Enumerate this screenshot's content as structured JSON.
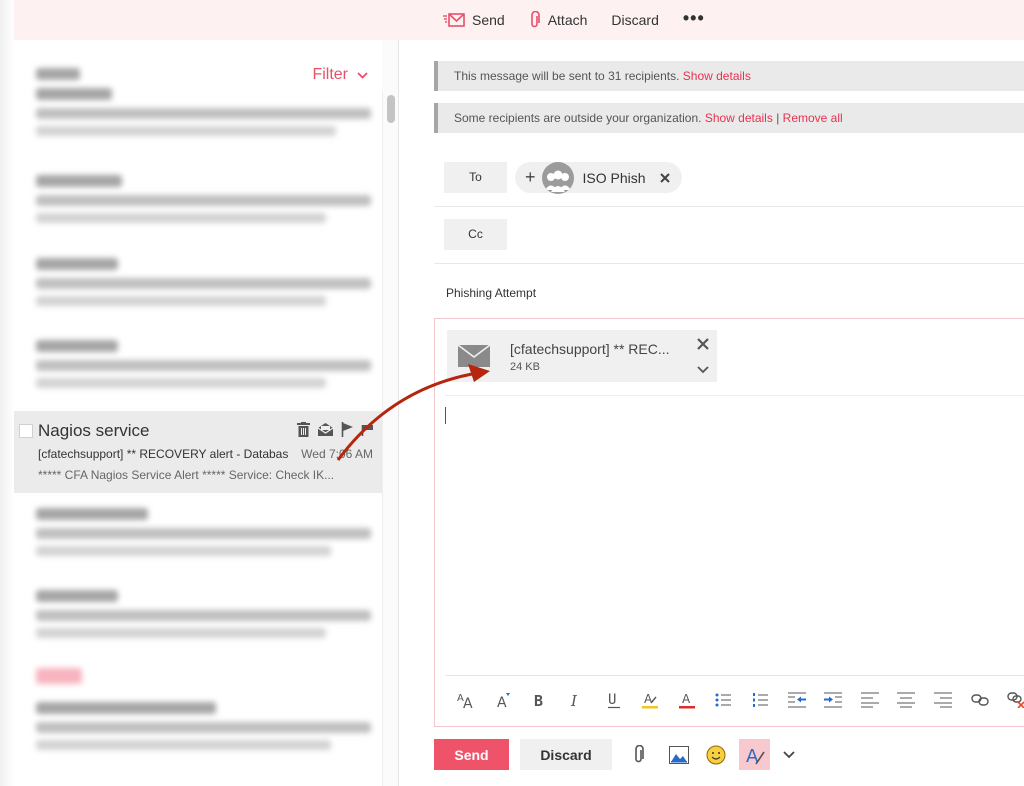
{
  "toolbar": {
    "send_label": "Send",
    "attach_label": "Attach",
    "discard_label": "Discard",
    "more_label": "•••"
  },
  "list": {
    "filter_label": "Filter",
    "selected_message": {
      "sender": "Nagios service",
      "subject": "[cfatechsupport] ** RECOVERY alert - Databas",
      "date": "Wed 7:06 AM",
      "preview": "***** CFA Nagios Service Alert ***** Service: Check IK..."
    }
  },
  "compose": {
    "info_recipients": {
      "text": "This message will be sent to 31 recipients. ",
      "link": "Show details"
    },
    "info_external": {
      "text": "Some recipients are outside your organization. ",
      "link1": "Show details",
      "separator": " | ",
      "link2": "Remove all"
    },
    "to_label": "To",
    "cc_label": "Cc",
    "recipient": {
      "plus": "+",
      "name": "ISO Phish"
    },
    "subject": "Phishing Attempt",
    "attachment": {
      "name": "[cfatechsupport] ** REC...",
      "size": "24 KB"
    },
    "send_label": "Send",
    "discard_label": "Discard"
  },
  "formatting_toolbar": [
    "font-size-icon",
    "grow-font-icon",
    "bold-icon",
    "italic-icon",
    "underline-icon",
    "highlight-icon",
    "font-color-icon",
    "bullets-icon",
    "numbering-icon",
    "decrease-indent-icon",
    "increase-indent-icon",
    "align-left-icon",
    "align-center-icon",
    "align-right-icon",
    "link-icon",
    "remove-link-icon"
  ],
  "colors": {
    "accent": "#ef5369",
    "link": "#e8324f",
    "topbar_bg": "#fef1f2",
    "annotation_arrow": "#b5260f"
  }
}
